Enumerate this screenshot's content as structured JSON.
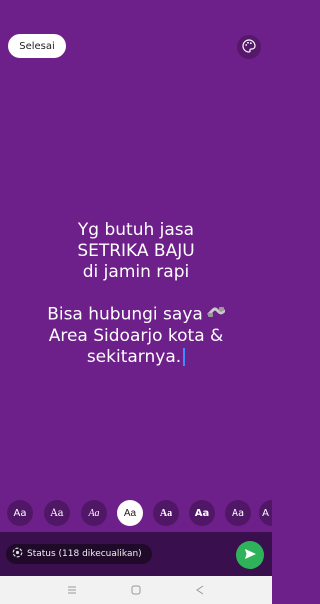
{
  "colors": {
    "background": "#6d1f8a",
    "text": "#ffffff",
    "send_button": "#2fb35a",
    "bottom_bar": "#3a0f4e"
  },
  "header": {
    "done_label": "Selesai",
    "palette_icon": "palette-icon"
  },
  "status": {
    "lines": [
      "Yg butuh jasa",
      "SETRIKA BAJU",
      "di jamin rapi",
      "",
      "Bisa hubungi saya",
      "Area Sidoarjo kota &",
      "sekitarnya."
    ],
    "emoji_icon": "telephone-icon"
  },
  "font_options": [
    {
      "label": "Aa",
      "selected": false
    },
    {
      "label": "Aa",
      "selected": false
    },
    {
      "label": "Aa",
      "selected": false
    },
    {
      "label": "Aa",
      "selected": true
    },
    {
      "label": "Aa",
      "selected": false
    },
    {
      "label": "Aa",
      "selected": false
    },
    {
      "label": "Aa",
      "selected": false
    },
    {
      "label": "A",
      "selected": false
    }
  ],
  "footer": {
    "audience_label": "Status (118 dikecualikan)",
    "send_icon": "send-icon"
  },
  "nav": {
    "icons": [
      "recents-icon",
      "home-icon",
      "back-icon"
    ]
  }
}
